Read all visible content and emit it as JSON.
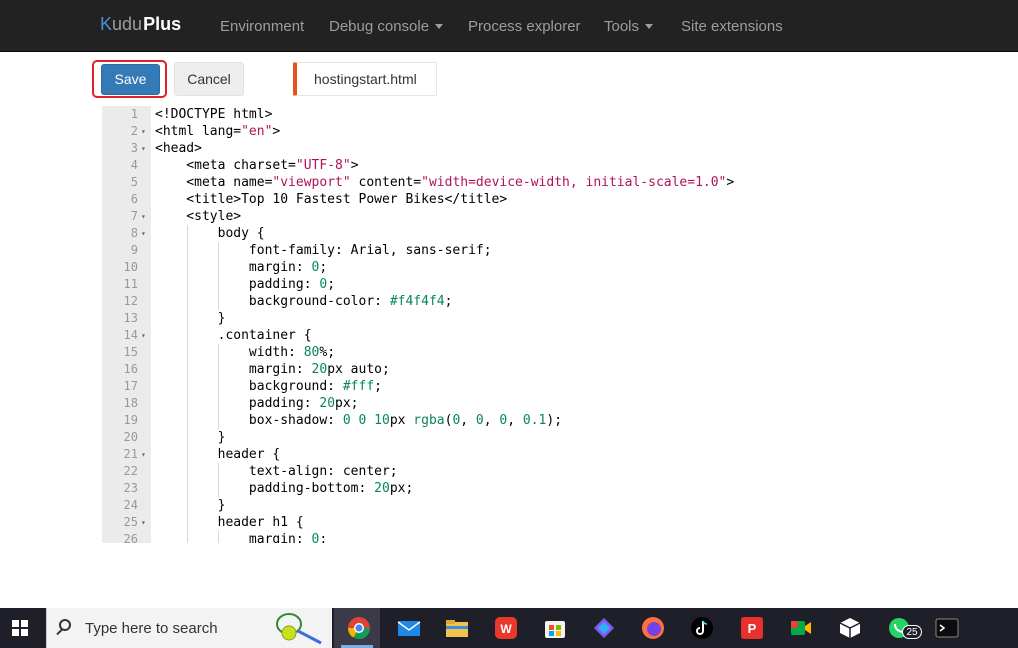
{
  "navbar": {
    "brand_prefix": "K",
    "brand_rest": "udu",
    "brand_plus": "Plus",
    "items": [
      {
        "label": "Environment"
      },
      {
        "label": "Debug console"
      },
      {
        "label": "Process explorer"
      },
      {
        "label": "Tools"
      },
      {
        "label": "Site extensions"
      }
    ]
  },
  "toolbar": {
    "save_label": "Save",
    "cancel_label": "Cancel",
    "file_tab": "hostingstart.html"
  },
  "editor": {
    "lines": [
      {
        "n": "1",
        "fold": ""
      },
      {
        "n": "2",
        "fold": "▾"
      },
      {
        "n": "3",
        "fold": "▾"
      },
      {
        "n": "4",
        "fold": ""
      },
      {
        "n": "5",
        "fold": ""
      },
      {
        "n": "6",
        "fold": ""
      },
      {
        "n": "7",
        "fold": "▾"
      },
      {
        "n": "8",
        "fold": "▾"
      },
      {
        "n": "9",
        "fold": ""
      },
      {
        "n": "10",
        "fold": ""
      },
      {
        "n": "11",
        "fold": ""
      },
      {
        "n": "12",
        "fold": ""
      },
      {
        "n": "13",
        "fold": ""
      },
      {
        "n": "14",
        "fold": "▾"
      },
      {
        "n": "15",
        "fold": ""
      },
      {
        "n": "16",
        "fold": ""
      },
      {
        "n": "17",
        "fold": ""
      },
      {
        "n": "18",
        "fold": ""
      },
      {
        "n": "19",
        "fold": ""
      },
      {
        "n": "20",
        "fold": ""
      },
      {
        "n": "21",
        "fold": "▾"
      },
      {
        "n": "22",
        "fold": ""
      },
      {
        "n": "23",
        "fold": ""
      },
      {
        "n": "24",
        "fold": ""
      },
      {
        "n": "25",
        "fold": "▾"
      },
      {
        "n": "26",
        "fold": ""
      }
    ],
    "code": {
      "l1": "<!DOCTYPE html>",
      "l2a": "<html lang=",
      "l2b": "\"en\"",
      "l2c": ">",
      "l3": "<head>",
      "l4a": "    <meta charset=",
      "l4b": "\"UTF-8\"",
      "l4c": ">",
      "l5a": "    <meta name=",
      "l5b": "\"viewport\"",
      "l5c": " content=",
      "l5d": "\"width=device-width, initial-scale=1.0\"",
      "l5e": ">",
      "l6": "    <title>Top 10 Fastest Power Bikes</title>",
      "l7": "    <style>",
      "l8": "        body {",
      "l9": "            font-family: Arial, sans-serif;",
      "l10a": "            margin: ",
      "l10b": "0",
      "l10c": ";",
      "l11a": "            padding: ",
      "l11b": "0",
      "l11c": ";",
      "l12a": "            background-color: ",
      "l12b": "#f4f4f4",
      "l12c": ";",
      "l13": "        }",
      "l14": "        .container {",
      "l15a": "            width: ",
      "l15b": "80",
      "l15c": "%;",
      "l16a": "            margin: ",
      "l16b": "20",
      "l16c": "px auto;",
      "l17a": "            background: ",
      "l17b": "#fff",
      "l17c": ";",
      "l18a": "            padding: ",
      "l18b": "20",
      "l18c": "px;",
      "l19a": "            box-shadow: ",
      "l19b": "0 0 10",
      "l19c": "px ",
      "l19d": "rgba",
      "l19e": "(",
      "l19f": "0",
      "l19g": ", ",
      "l19h": "0",
      "l19i": ", ",
      "l19j": "0",
      "l19k": ", ",
      "l19l": "0.1",
      "l19m": ");",
      "l20": "        }",
      "l21": "        header {",
      "l22": "            text-align: center;",
      "l23a": "            padding-bottom: ",
      "l23b": "20",
      "l23c": "px;",
      "l24": "        }",
      "l25": "        header h1 {",
      "l26a": "            margin: ",
      "l26b": "0",
      "l26c": ";"
    }
  },
  "taskbar": {
    "search_placeholder": "Type here to search",
    "whatsapp_badge": "25"
  },
  "colors": {
    "navbar_bg": "#222222",
    "save_blue": "#337ab7",
    "tab_accent": "#e2541e",
    "highlight_red": "#e0202a"
  }
}
